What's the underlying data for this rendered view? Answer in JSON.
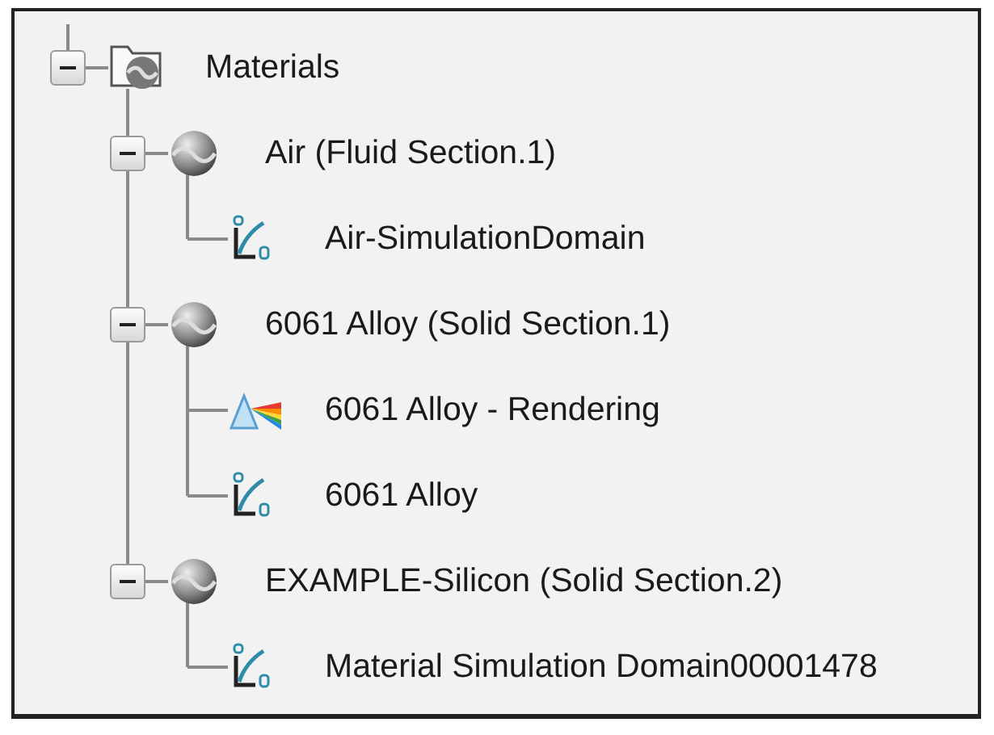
{
  "tree": [
    {
      "label": "Materials",
      "kind": "folder",
      "expanded": true,
      "children": [
        {
          "label": "Air (Fluid Section.1)",
          "kind": "material",
          "expanded": true,
          "children": [
            {
              "label": "Air-SimulationDomain",
              "kind": "simulation"
            }
          ]
        },
        {
          "label": "6061 Alloy (Solid Section.1)",
          "kind": "material",
          "expanded": true,
          "children": [
            {
              "label": "6061 Alloy - Rendering",
              "kind": "rendering"
            },
            {
              "label": "6061 Alloy",
              "kind": "simulation"
            }
          ]
        },
        {
          "label": "EXAMPLE-Silicon (Solid Section.2)",
          "kind": "material",
          "expanded": true,
          "children": [
            {
              "label": "Material Simulation Domain00001478",
              "kind": "simulation"
            }
          ]
        }
      ]
    }
  ]
}
